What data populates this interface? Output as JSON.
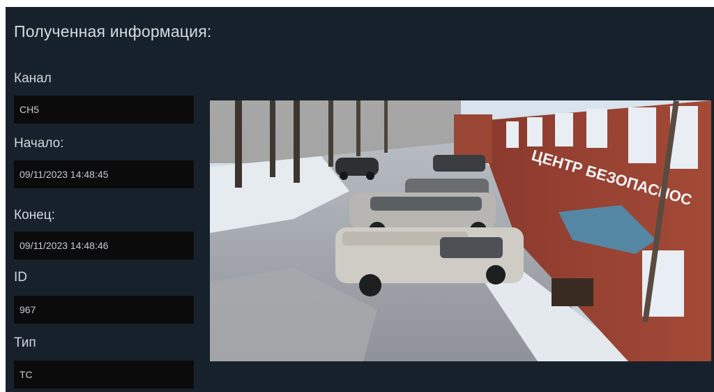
{
  "panel": {
    "title": "Полученная информация:"
  },
  "fields": {
    "channel": {
      "label": "Канал",
      "value": "CH5"
    },
    "start": {
      "label": "Начало:",
      "value": "09/11/2023 14:48:45"
    },
    "end": {
      "label": "Конец:",
      "value": "09/11/2023 14:48:46"
    },
    "id": {
      "label": "ID",
      "value": "967"
    },
    "type": {
      "label": "Тип",
      "value": "ТС"
    }
  },
  "snapshot": {
    "building_sign": "ЦЕНТР БЕЗОПАСНОС"
  },
  "colors": {
    "panel_bg": "#17212b",
    "field_bg": "#0b0b0c",
    "text": "#d0d6dc"
  }
}
